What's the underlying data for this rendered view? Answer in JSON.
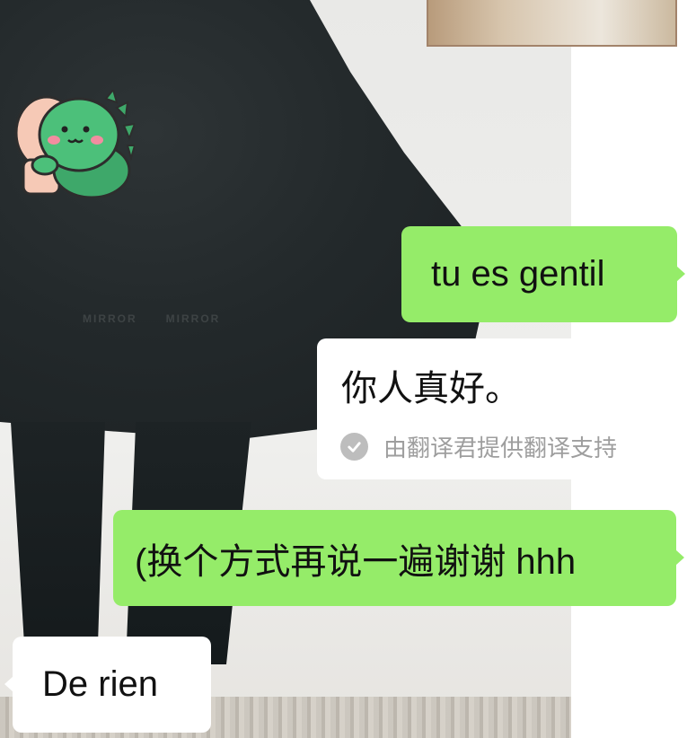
{
  "chat": {
    "messages": [
      {
        "side": "right",
        "text": "tu es gentil"
      },
      {
        "side": "left",
        "text": "你人真好。",
        "note": "由翻译君提供翻译支持",
        "note_icon": "check-circle-icon"
      },
      {
        "side": "right",
        "text": "(换个方式再说一遍谢谢 hhh"
      },
      {
        "side": "left",
        "text": "De rien"
      }
    ],
    "sticker": "green-dinosaur-hug-sticker",
    "colors": {
      "sent_bubble": "#95ec69",
      "received_bubble": "#ffffff",
      "note_text": "#9e9e9e"
    }
  }
}
